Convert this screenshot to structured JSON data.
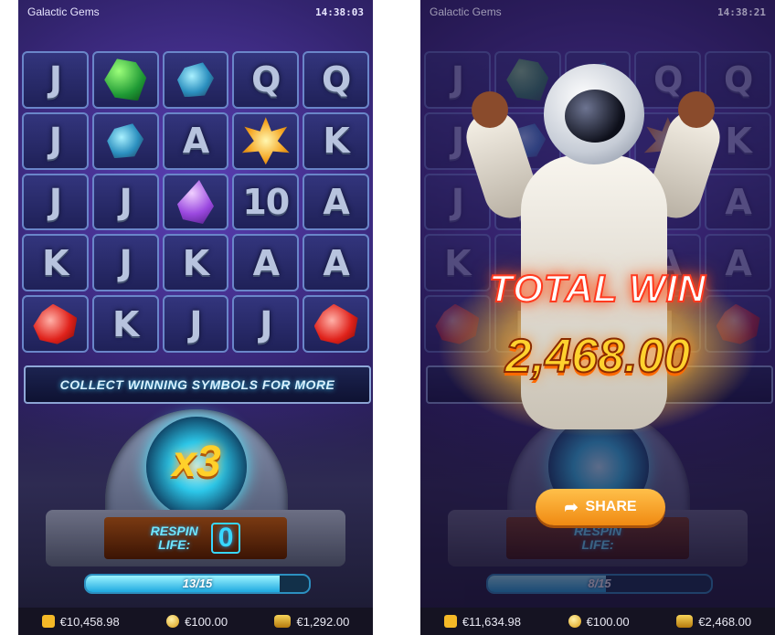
{
  "left": {
    "title": "Galactic Gems",
    "clock": "14:38:03",
    "grid": [
      [
        {
          "t": "J"
        },
        {
          "gem": "green"
        },
        {
          "gem": "blue"
        },
        {
          "t": "Q"
        },
        {
          "t": "Q"
        }
      ],
      [
        {
          "t": "J"
        },
        {
          "gem": "blue"
        },
        {
          "t": "A"
        },
        {
          "gem": "gold"
        },
        {
          "t": "K"
        }
      ],
      [
        {
          "t": "J"
        },
        {
          "t": "J"
        },
        {
          "gem": "purple"
        },
        {
          "t": "10"
        },
        {
          "t": "A"
        }
      ],
      [
        {
          "t": "K"
        },
        {
          "t": "J"
        },
        {
          "t": "K"
        },
        {
          "t": "A"
        },
        {
          "t": "A"
        }
      ],
      [
        {
          "gem": "red"
        },
        {
          "t": "K"
        },
        {
          "t": "J"
        },
        {
          "t": "J"
        },
        {
          "gem": "red"
        }
      ]
    ],
    "banner": "COLLECT WINNING SYMBOLS FOR MORE",
    "multiplier": "x3",
    "respin_label_1": "RESPIN",
    "respin_label_2": "LIFE:",
    "respin_value": "0",
    "progress_text": "13/15",
    "progress_fraction": 0.87,
    "balance": "€10,458.98",
    "bet": "€100.00",
    "win": "€1,292.00"
  },
  "right": {
    "title": "Galactic Gems",
    "clock": "14:38:21",
    "total_win_title": "TOTAL WIN",
    "total_win_amount": "2,468.00",
    "share_label": "SHARE",
    "respin_label_1": "RESPIN",
    "respin_label_2": "LIFE:",
    "progress_text": "8/15",
    "progress_fraction": 0.53,
    "balance": "€11,634.98",
    "bet": "€100.00",
    "win": "€2,468.00"
  },
  "colors": {
    "accent_cyan": "#38d7ff",
    "gold": "#ffd22e",
    "share_orange": "#f08a12"
  }
}
